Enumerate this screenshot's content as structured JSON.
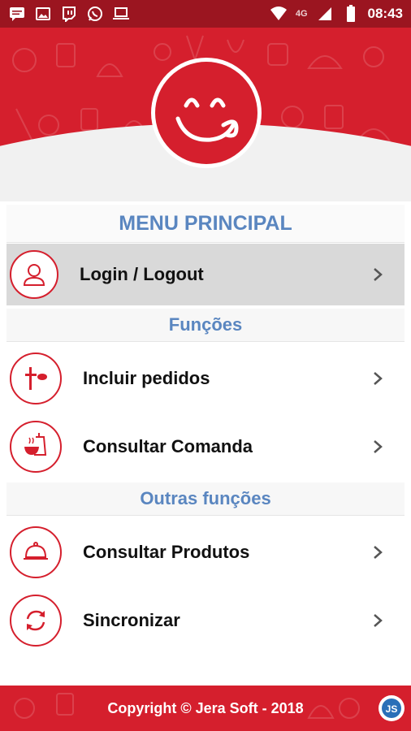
{
  "status_bar": {
    "time": "08:43",
    "network": "4G",
    "left_icons": [
      "message-icon",
      "image-icon",
      "twitch-icon",
      "whatsapp-icon",
      "laptop-icon"
    ],
    "right_icons": [
      "wifi-icon",
      "signal-icon",
      "battery-icon"
    ]
  },
  "header": {
    "logo": "smiley-face-logo"
  },
  "menu": {
    "title": "MENU PRINCIPAL",
    "login_label": "Login / Logout",
    "section_functions": "Funções",
    "incluir_label": "Incluir pedidos",
    "comanda_label": "Consultar Comanda",
    "section_other": "Outras funções",
    "produtos_label": "Consultar Produtos",
    "sync_label": "Sincronizar"
  },
  "footer": {
    "copyright": "Copyright © Jera Soft - 2018",
    "badge": "JS"
  },
  "colors": {
    "primary": "#d51f2d",
    "status": "#9b1520",
    "accent_text": "#5a86c0",
    "selected_row": "#d9d9d9"
  }
}
